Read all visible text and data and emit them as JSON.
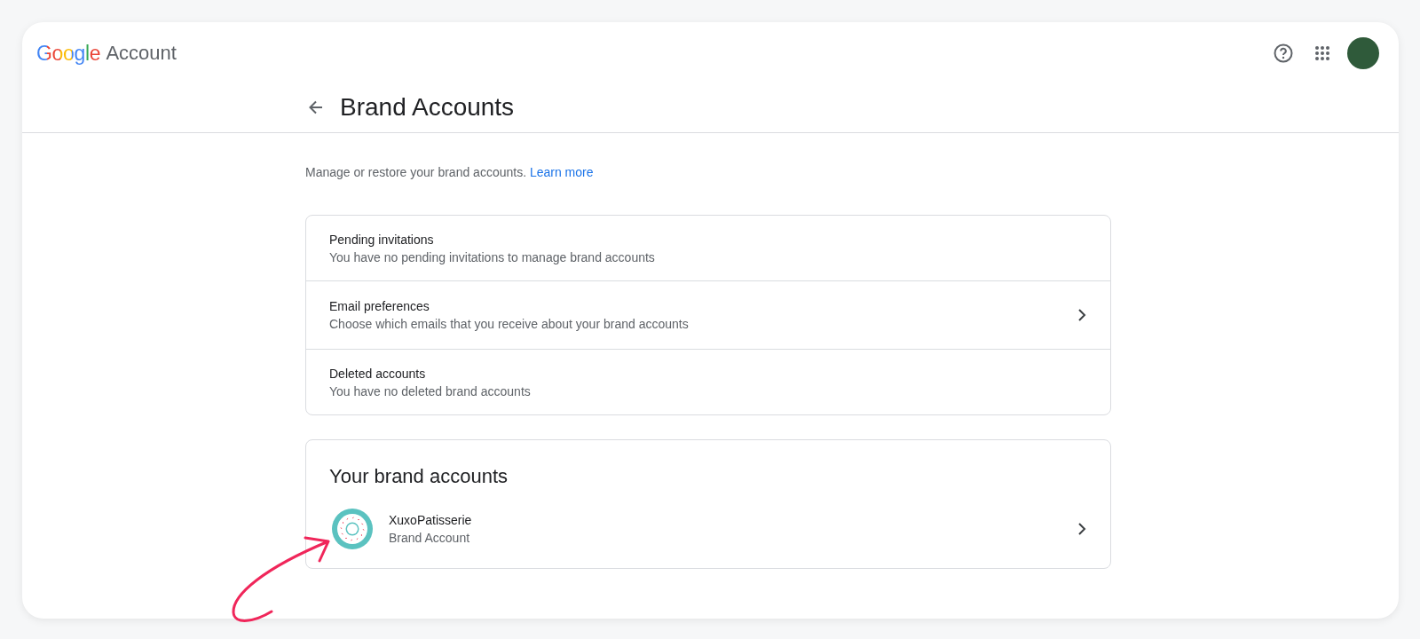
{
  "header": {
    "logo": "Google",
    "product": "Account"
  },
  "page": {
    "title": "Brand Accounts",
    "description": "Manage or restore your brand accounts.",
    "link": "Learn more"
  },
  "settings": [
    {
      "title": "Pending invitations",
      "subtitle": "You have no pending invitations to manage brand accounts",
      "chevron": false
    },
    {
      "title": "Email preferences",
      "subtitle": "Choose which emails that you receive about your brand accounts",
      "chevron": true
    },
    {
      "title": "Deleted accounts",
      "subtitle": "You have no deleted brand accounts",
      "chevron": false
    }
  ],
  "brand_accounts": {
    "title": "Your brand accounts",
    "items": [
      {
        "name": "XuxoPatisserie",
        "type": "Brand Account",
        "chevron": true
      }
    ]
  }
}
